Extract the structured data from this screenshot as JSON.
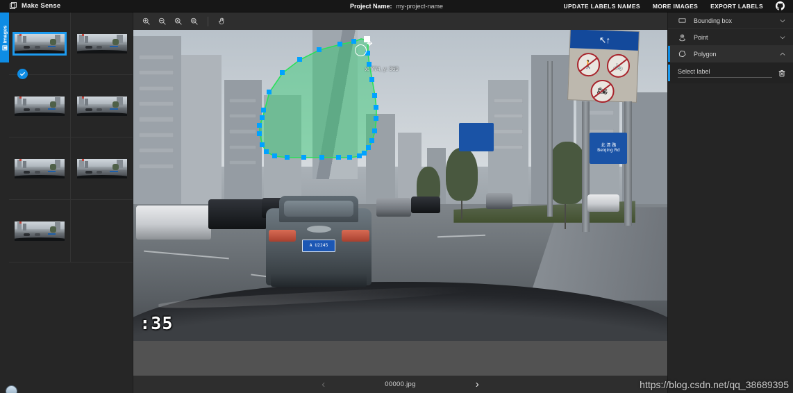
{
  "app": {
    "brand": "Make Sense",
    "brand_icon": "overlapping-squares-icon"
  },
  "header": {
    "project_label": "Project Name:",
    "project_value": "my-project-name",
    "actions": [
      {
        "label": "UPDATE LABELS NAMES",
        "name": "update-labels-names-button"
      },
      {
        "label": "MORE IMAGES",
        "name": "more-images-button"
      },
      {
        "label": "EXPORT LABELS",
        "name": "export-labels-button"
      }
    ],
    "github_icon": "github-icon"
  },
  "images_tab": {
    "label": "Images",
    "icon": "images-icon"
  },
  "thumbnails": {
    "count": 7,
    "selected_index": 0,
    "items": [
      {
        "name": "thumbnail-0",
        "selected": true,
        "badge": "check-icon"
      },
      {
        "name": "thumbnail-1",
        "selected": false,
        "badge": ""
      },
      {
        "name": "thumbnail-2",
        "selected": false,
        "badge": ""
      },
      {
        "name": "thumbnail-3",
        "selected": false,
        "badge": ""
      },
      {
        "name": "thumbnail-4",
        "selected": false,
        "badge": ""
      },
      {
        "name": "thumbnail-5",
        "selected": false,
        "badge": ""
      },
      {
        "name": "thumbnail-6",
        "selected": false,
        "badge": ""
      }
    ]
  },
  "toolbar": {
    "buttons": [
      {
        "icon": "zoom-in-icon",
        "name": "zoom-in-button"
      },
      {
        "icon": "zoom-out-icon",
        "name": "zoom-out-button"
      },
      {
        "icon": "zoom-fit-icon",
        "name": "zoom-fit-button"
      },
      {
        "icon": "zoom-max-icon",
        "name": "zoom-max-button"
      },
      {
        "icon": "hand-icon",
        "name": "pan-tool-button"
      }
    ]
  },
  "canvas": {
    "timestamp_overlay": ":35",
    "cursor": {
      "coords_text": "x: 774, y: 369",
      "icon": "move-crosshair-icon"
    },
    "annotation": {
      "type": "polygon",
      "fill_color": "#2ecc71",
      "stroke_color": "#29e05a",
      "vertex_color": "#00a2ff",
      "vertex_count": 30
    },
    "sign_texts": {
      "blue_top": "↖↑",
      "small_blue_line1": "北 清 路",
      "small_blue_line2": "Beiqing Rd"
    },
    "plate_text": "A U2245"
  },
  "bottom_nav": {
    "prev_icon": "chevron-left-icon",
    "next_icon": "chevron-right-icon",
    "filename": "00000.jpg"
  },
  "right_panel": {
    "sections": [
      {
        "label": "Bounding box",
        "icon": "rectangle-icon",
        "chevron": "chevron-down-icon",
        "expanded": false
      },
      {
        "label": "Point",
        "icon": "point-pin-icon",
        "chevron": "chevron-down-icon",
        "expanded": false
      },
      {
        "label": "Polygon",
        "icon": "polygon-icon",
        "chevron": "chevron-up-icon",
        "expanded": true
      }
    ],
    "label_row": {
      "placeholder": "Select label",
      "delete_icon": "trash-icon"
    }
  },
  "watermark": {
    "text": "https://blog.csdn.net/qq_38689395"
  },
  "colors": {
    "accent_blue": "#0e8ce4",
    "panel_bg": "#252525",
    "topbar_bg": "#171717",
    "canvas_bg": "#525252",
    "annotation_green": "#29e05a"
  }
}
